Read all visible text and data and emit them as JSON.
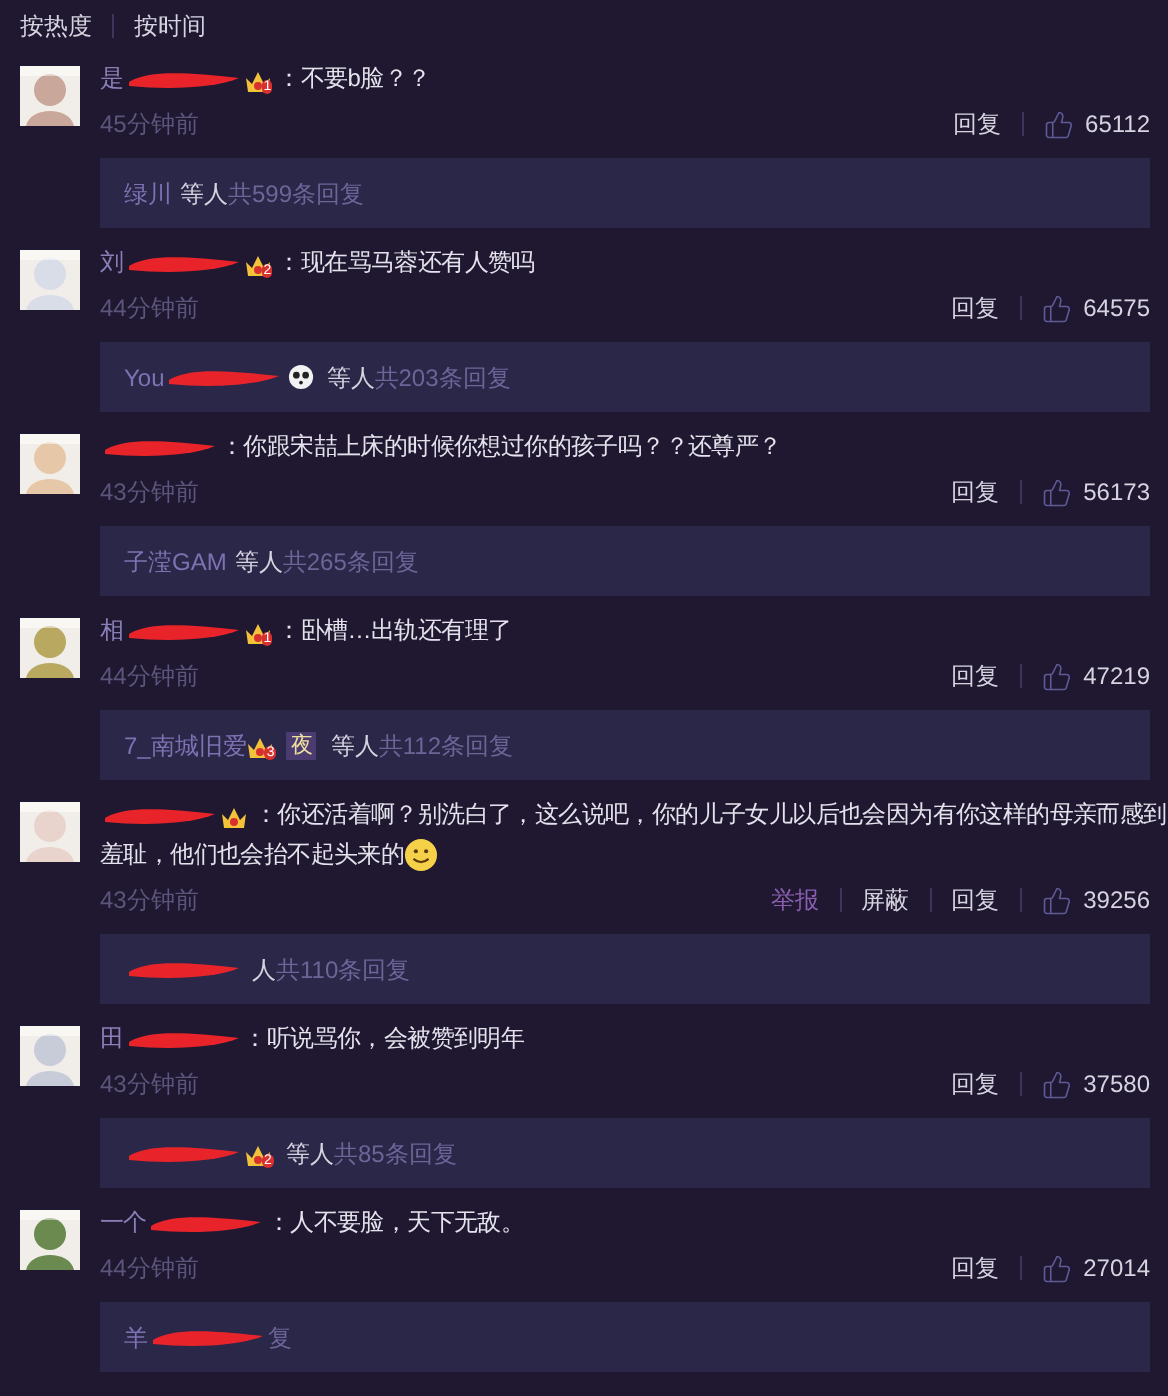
{
  "sort_tabs": [
    {
      "label": "按热度"
    },
    {
      "label": "按时间"
    }
  ],
  "comments": [
    {
      "avatar": {
        "kind": "picture"
      },
      "name": [
        {
          "kind": "text",
          "text": "是"
        },
        {
          "kind": "redaction"
        },
        {
          "kind": "crown",
          "text": "1"
        }
      ],
      "text": [
        {
          "kind": "text",
          "text": "：不要b脸？？"
        }
      ],
      "time": "45分钟前",
      "actions": [
        {
          "kind": "plain",
          "label": "回复"
        }
      ],
      "likes": "65112",
      "replies": {
        "parts": [
          {
            "kind": "text",
            "text": "绿川"
          }
        ],
        "suffix": "等人",
        "count": "共599条回复"
      }
    },
    {
      "avatar": {
        "kind": "picture"
      },
      "name": [
        {
          "kind": "text",
          "text": "刘"
        },
        {
          "kind": "redaction"
        },
        {
          "kind": "crown",
          "text": "2"
        }
      ],
      "text": [
        {
          "kind": "text",
          "text": "：现在骂马蓉还有人赞吗"
        }
      ],
      "time": "44分钟前",
      "actions": [
        {
          "kind": "plain",
          "label": "回复"
        }
      ],
      "likes": "64575",
      "replies": {
        "parts": [
          {
            "kind": "text",
            "text": "You"
          },
          {
            "kind": "redaction"
          },
          {
            "kind": "panda"
          }
        ],
        "suffix": "等人",
        "count": "共203条回复"
      }
    },
    {
      "avatar": {
        "kind": "picture"
      },
      "name": [
        {
          "kind": "redaction"
        }
      ],
      "text": [
        {
          "kind": "text",
          "text": "：你跟宋喆上床的时候你想过你的孩子吗？？还尊严？"
        }
      ],
      "time": "43分钟前",
      "actions": [
        {
          "kind": "plain",
          "label": "回复"
        }
      ],
      "likes": "56173",
      "replies": {
        "parts": [
          {
            "kind": "text",
            "text": "子滢GAM"
          }
        ],
        "suffix": "等人",
        "count": "共265条回复"
      }
    },
    {
      "avatar": {
        "kind": "picture"
      },
      "name": [
        {
          "kind": "text",
          "text": "相"
        },
        {
          "kind": "redaction"
        },
        {
          "kind": "crown",
          "text": "1"
        }
      ],
      "text": [
        {
          "kind": "text",
          "text": "：卧槽…出轨还有理了"
        }
      ],
      "time": "44分钟前",
      "actions": [
        {
          "kind": "plain",
          "label": "回复"
        }
      ],
      "likes": "47219",
      "replies": {
        "parts": [
          {
            "kind": "text",
            "text": "7_南城旧爱"
          },
          {
            "kind": "crown",
            "text": "3"
          },
          {
            "kind": "square",
            "text": "夜"
          }
        ],
        "suffix": "等人",
        "count": "共112条回复"
      }
    },
    {
      "avatar": {
        "kind": "picture"
      },
      "name": [
        {
          "kind": "redaction"
        },
        {
          "kind": "crown"
        }
      ],
      "text": [
        {
          "kind": "text",
          "text": "：你还活着啊？别洗白了，这么说吧，你的儿子女儿以后也会因为有你这样的母亲而感到"
        },
        {
          "kind": "break"
        },
        {
          "kind": "text",
          "text": "羞耻，他们也会抬不起头来的"
        },
        {
          "kind": "smile"
        }
      ],
      "time": "43分钟前",
      "actions": [
        {
          "kind": "report",
          "label": "举报"
        },
        {
          "kind": "plain",
          "label": "屏蔽"
        },
        {
          "kind": "plain",
          "label": "回复"
        }
      ],
      "likes": "39256",
      "replies": {
        "parts": [
          {
            "kind": "redaction"
          }
        ],
        "suffix": "人",
        "count": "共110条回复"
      }
    },
    {
      "avatar": {
        "kind": "picture"
      },
      "name": [
        {
          "kind": "text",
          "text": "田"
        },
        {
          "kind": "redaction"
        }
      ],
      "text": [
        {
          "kind": "text",
          "text": "：听说骂你，会被赞到明年"
        }
      ],
      "time": "43分钟前",
      "actions": [
        {
          "kind": "plain",
          "label": "回复"
        }
      ],
      "likes": "37580",
      "replies": {
        "parts": [
          {
            "kind": "redaction"
          },
          {
            "kind": "crown",
            "text": "2"
          }
        ],
        "suffix": "等人",
        "count": "共85条回复"
      }
    },
    {
      "avatar": {
        "kind": "picture"
      },
      "name": [
        {
          "kind": "text",
          "text": "一个"
        },
        {
          "kind": "redaction"
        }
      ],
      "text": [
        {
          "kind": "text",
          "text": "：人不要脸，天下无敌。"
        }
      ],
      "time": "44分钟前",
      "actions": [
        {
          "kind": "plain",
          "label": "回复"
        }
      ],
      "likes": "27014",
      "replies": {
        "parts": [
          {
            "kind": "text",
            "text": "羊"
          },
          {
            "kind": "redaction"
          }
        ],
        "count": "复"
      }
    }
  ]
}
